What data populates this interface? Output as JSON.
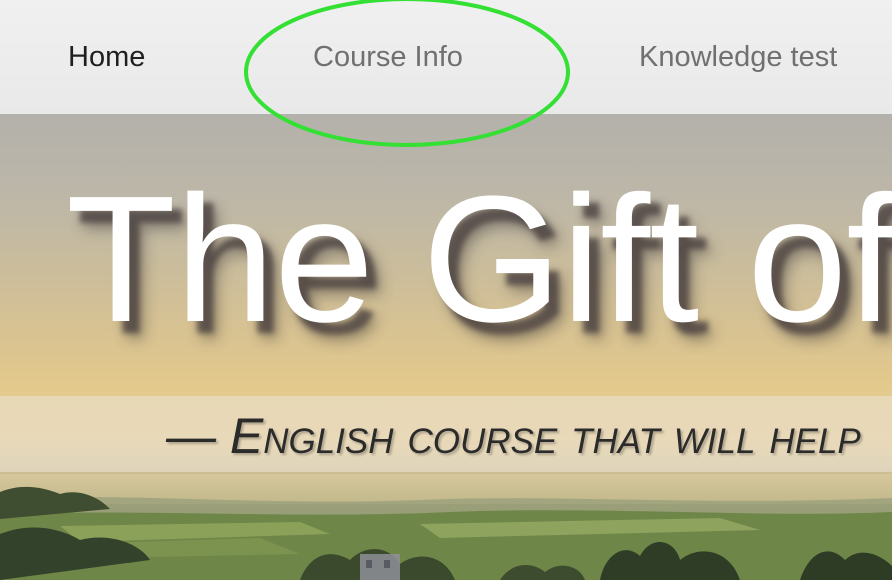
{
  "nav": {
    "items": [
      {
        "label": "Home"
      },
      {
        "label": "Course Info"
      },
      {
        "label": "Knowledge test"
      }
    ]
  },
  "hero": {
    "title": "The Gift of",
    "subtitle": "— English course that will help"
  },
  "colors": {
    "nav_background": "#ececed",
    "nav_active_text": "#1f1f1f",
    "nav_text": "#707070",
    "highlight_ellipse": "#35e035",
    "title_text": "#ffffff",
    "subtitle_text": "#2b2b2b"
  }
}
